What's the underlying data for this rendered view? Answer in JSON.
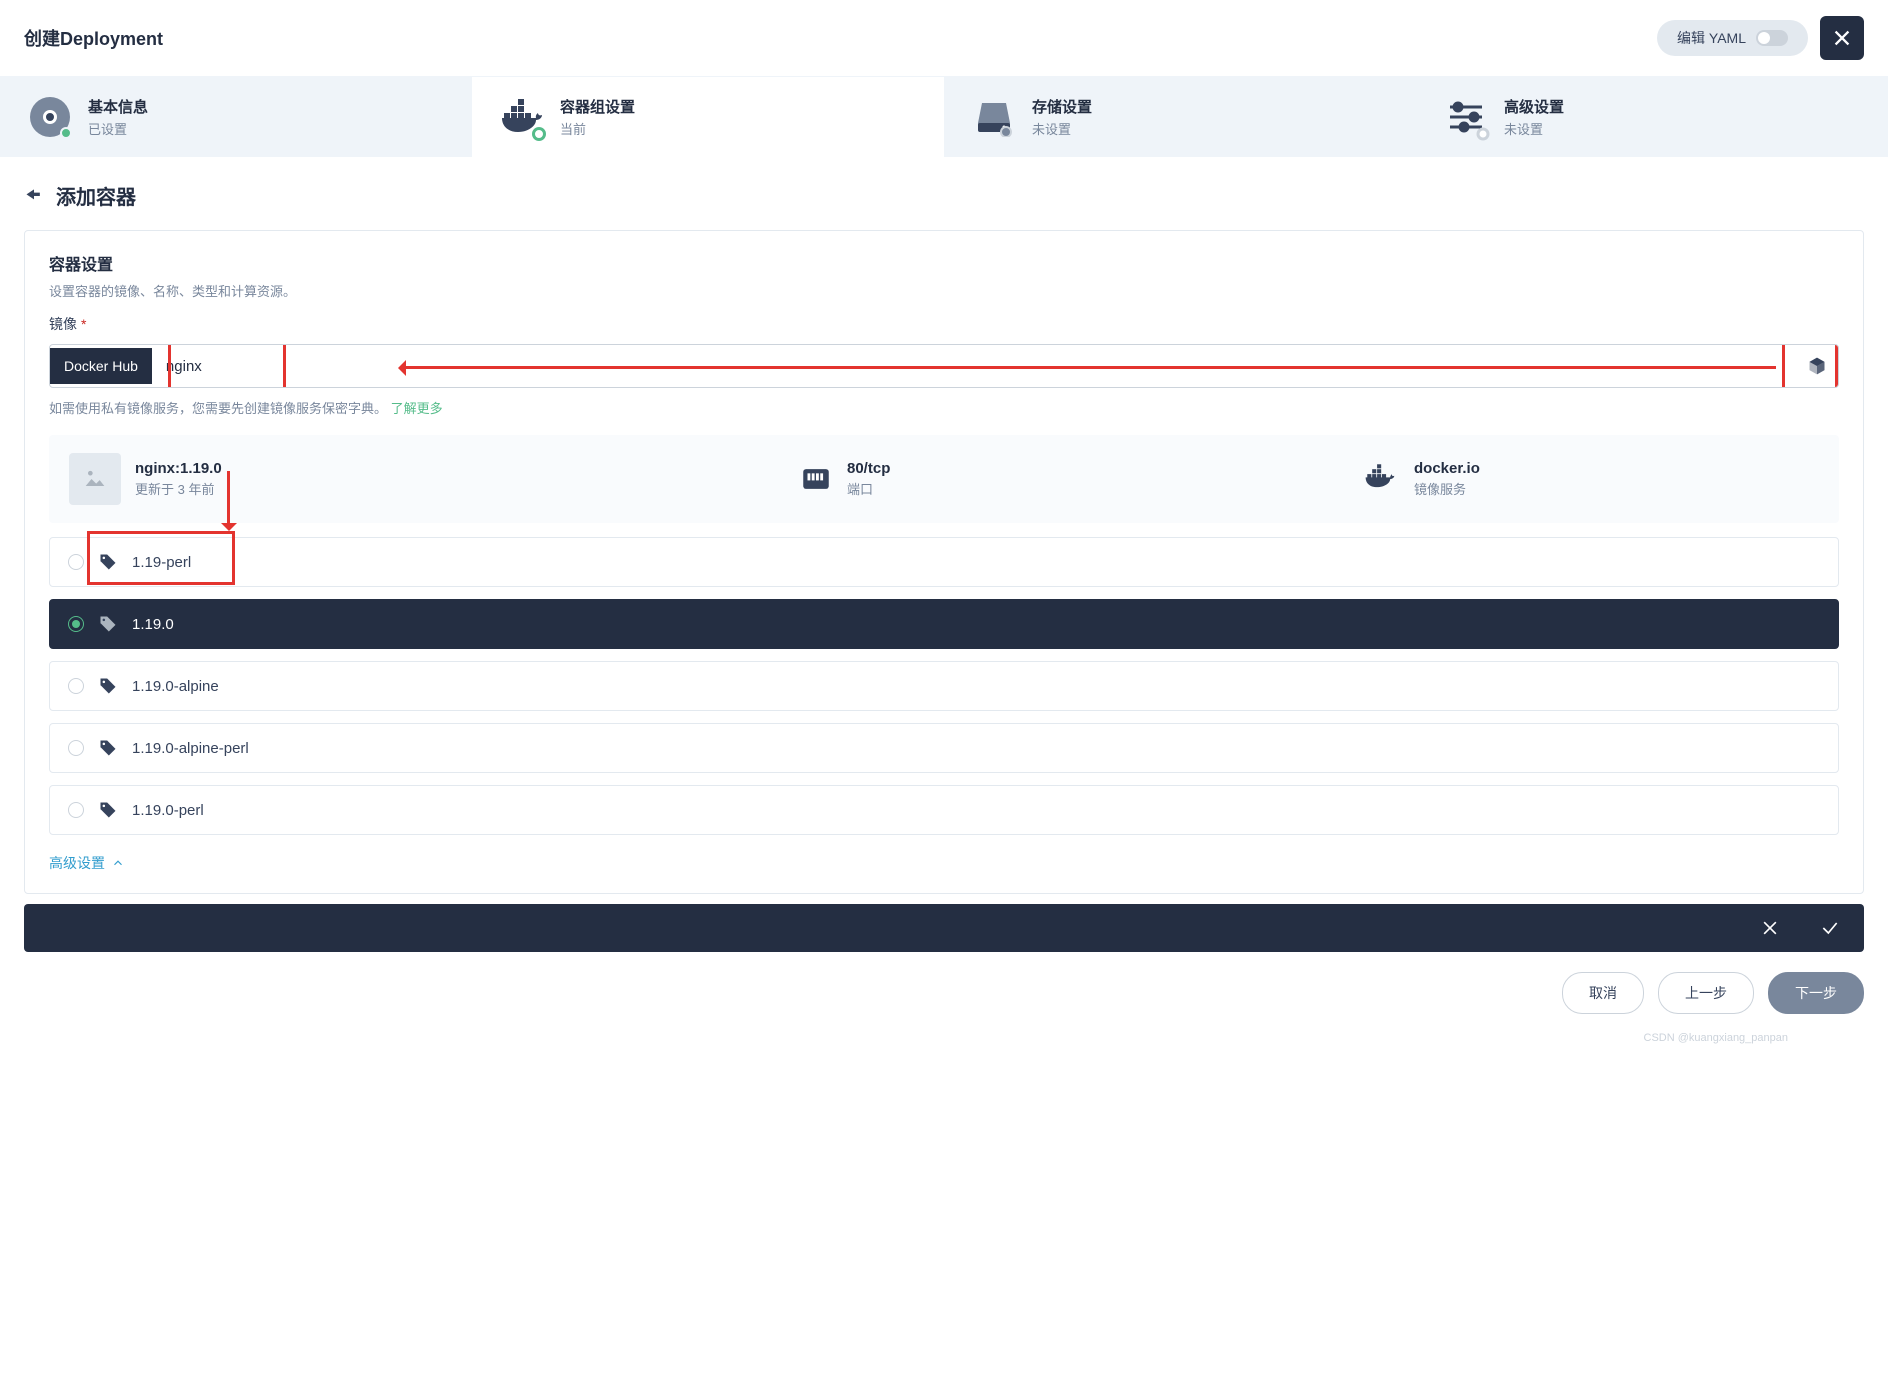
{
  "header": {
    "title": "创建Deployment",
    "edit_yaml": "编辑 YAML"
  },
  "steps": [
    {
      "title": "基本信息",
      "status": "已设置"
    },
    {
      "title": "容器组设置",
      "status": "当前"
    },
    {
      "title": "存储设置",
      "status": "未设置"
    },
    {
      "title": "高级设置",
      "status": "未设置"
    }
  ],
  "section": {
    "title": "添加容器"
  },
  "container": {
    "title": "容器设置",
    "desc": "设置容器的镜像、名称、类型和计算资源。",
    "image_label": "镜像",
    "badge": "Docker Hub",
    "value": "nginx",
    "hint_prefix": "如需使用私有镜像服务，您需要先创建镜像服务保密字典。",
    "hint_link": "了解更多"
  },
  "info": {
    "image_name": "nginx:1.19.0",
    "image_sub": "更新于 3 年前",
    "port": "80/tcp",
    "port_label": "端口",
    "registry": "docker.io",
    "registry_label": "镜像服务"
  },
  "tags": [
    {
      "label": "1.19-perl",
      "selected": false
    },
    {
      "label": "1.19.0",
      "selected": true
    },
    {
      "label": "1.19.0-alpine",
      "selected": false
    },
    {
      "label": "1.19.0-alpine-perl",
      "selected": false
    },
    {
      "label": "1.19.0-perl",
      "selected": false
    }
  ],
  "adv_link": "高级设置",
  "footer": {
    "cancel": "取消",
    "prev": "上一步",
    "next": "下一步"
  },
  "watermark": "CSDN @kuangxiang_panpan"
}
